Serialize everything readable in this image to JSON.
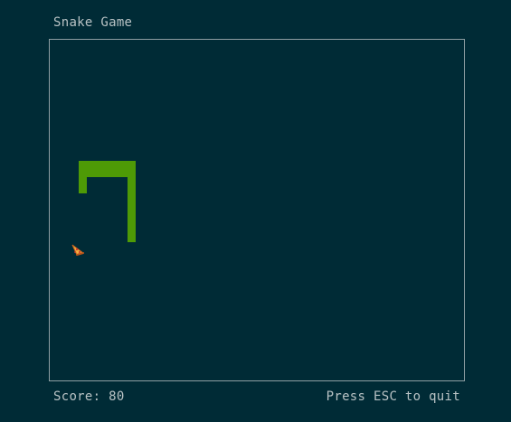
{
  "header": {
    "title": "Snake Game"
  },
  "game": {
    "snake_color": "#4e9a06",
    "food_icon": "pizza-icon",
    "background_color": "#002b36",
    "border_color": "#8f9fa3"
  },
  "footer": {
    "score_text": "Score: 80",
    "quit_hint": "Press ESC to quit"
  }
}
